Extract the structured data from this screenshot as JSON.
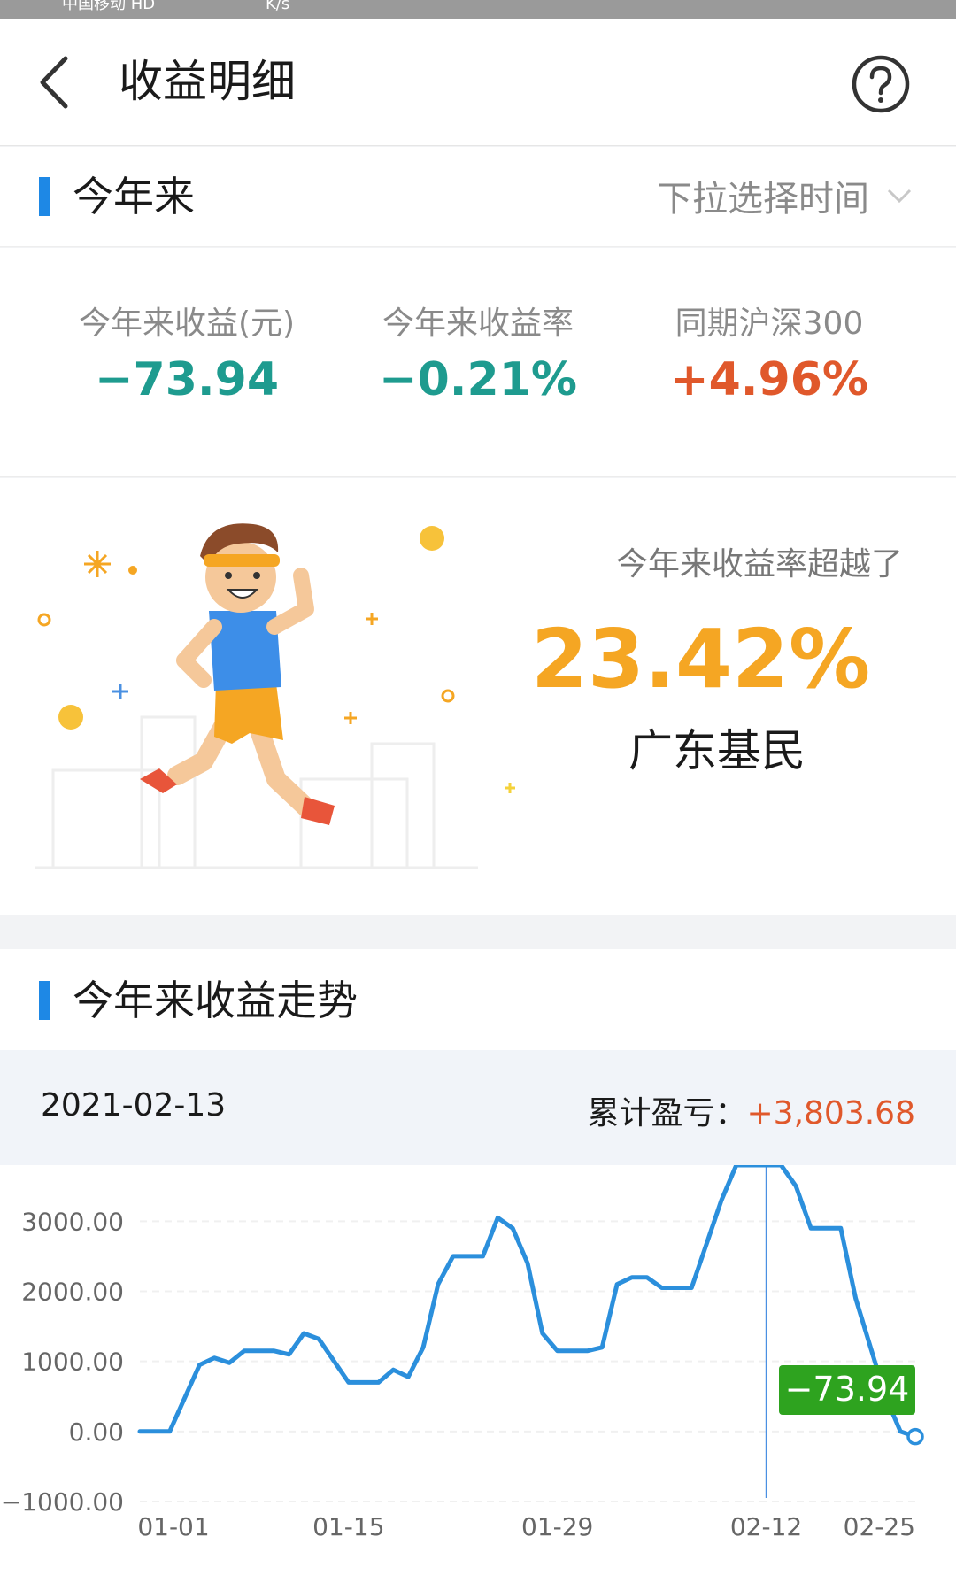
{
  "nav": {
    "title": "收益明细"
  },
  "period": {
    "label": "今年来",
    "picker": "下拉选择时间"
  },
  "stats": [
    {
      "label": "今年来收益(元)",
      "value": "−73.94",
      "color": "#1e9b8f"
    },
    {
      "label": "今年来收益率",
      "value": "−0.21%",
      "color": "#1e9b8f"
    },
    {
      "label": "同期沪深300",
      "value": "+4.96%",
      "color": "#e0582b"
    }
  ],
  "promo": {
    "title": "今年来收益率超越了",
    "value": "23.42%",
    "place": "广东基民"
  },
  "trend": {
    "label": "今年来收益走势"
  },
  "chart_info": {
    "date": "2021-02-13",
    "cum_label": "累计盈亏：",
    "cum_value": "+3,803.68"
  },
  "colors": {
    "accent": "#1e88e5",
    "down": "#1e9b8f",
    "up": "#e0582b",
    "gold": "#f5a623",
    "end_badge": "#2ea31f"
  },
  "chart_data": {
    "type": "line",
    "title": "",
    "x_tick_labels": [
      "01-01",
      "01-15",
      "01-29",
      "02-12",
      "02-25"
    ],
    "y_tick_labels": [
      "3000.00",
      "2000.00",
      "1000.00",
      "0.00",
      "−1000.00"
    ],
    "ylim": [
      -1000,
      3800
    ],
    "grid": true,
    "series": [
      {
        "points": [
          [
            1,
            0
          ],
          [
            3,
            0
          ],
          [
            5,
            950
          ],
          [
            6,
            1050
          ],
          [
            7,
            980
          ],
          [
            8,
            1150
          ],
          [
            10,
            1150
          ],
          [
            11,
            1100
          ],
          [
            12,
            1400
          ],
          [
            13,
            1320
          ],
          [
            15,
            700
          ],
          [
            17,
            700
          ],
          [
            18,
            880
          ],
          [
            19,
            780
          ],
          [
            20,
            1200
          ],
          [
            21,
            2100
          ],
          [
            22,
            2500
          ],
          [
            24,
            2500
          ],
          [
            25,
            3050
          ],
          [
            26,
            2900
          ],
          [
            27,
            2400
          ],
          [
            28,
            1400
          ],
          [
            29,
            1150
          ],
          [
            31,
            1150
          ],
          [
            32,
            1200
          ],
          [
            33,
            2100
          ],
          [
            34,
            2200
          ],
          [
            35,
            2200
          ],
          [
            36,
            2050
          ],
          [
            38,
            2050
          ],
          [
            40,
            3300
          ],
          [
            41,
            3803.68
          ],
          [
            44,
            3803.68
          ],
          [
            45,
            3500
          ],
          [
            46,
            2900
          ],
          [
            48,
            2900
          ],
          [
            49,
            1900
          ],
          [
            51,
            500
          ],
          [
            52,
            0
          ],
          [
            53,
            -73.94
          ]
        ]
      }
    ],
    "highlight": {
      "x_label": "02-12",
      "y": 3803.68
    },
    "end_label": "−73.94"
  }
}
